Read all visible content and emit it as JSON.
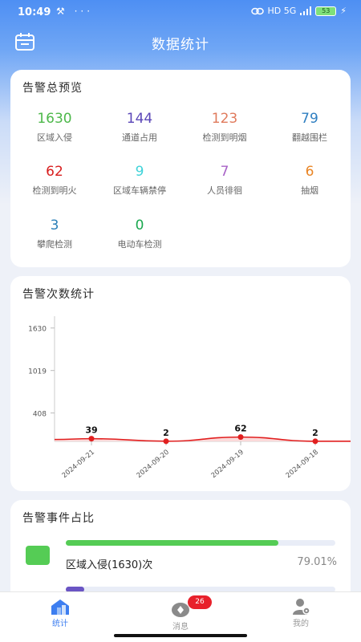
{
  "status_bar": {
    "time": "10:49",
    "left_icons": "⚒ ···",
    "net": "HD 5G",
    "battery": "53"
  },
  "header": {
    "title": "数据统计"
  },
  "overview": {
    "title": "告警总预览",
    "stats": [
      {
        "value": "1630",
        "label": "区域入侵",
        "color": "#4db84a"
      },
      {
        "value": "144",
        "label": "通道占用",
        "color": "#5b47b8"
      },
      {
        "value": "123",
        "label": "检测到明烟",
        "color": "#e07b5d"
      },
      {
        "value": "79",
        "label": "翻越围栏",
        "color": "#2f7fc1"
      },
      {
        "value": "62",
        "label": "检测到明火",
        "color": "#d81e1e"
      },
      {
        "value": "9",
        "label": "区域车辆禁停",
        "color": "#3fd3d9"
      },
      {
        "value": "7",
        "label": "人员徘徊",
        "color": "#a862c7"
      },
      {
        "value": "6",
        "label": "抽烟",
        "color": "#e98525"
      },
      {
        "value": "3",
        "label": "攀爬检测",
        "color": "#2b7fb8"
      },
      {
        "value": "0",
        "label": "电动车检测",
        "color": "#1aa84f"
      }
    ]
  },
  "count_chart": {
    "title": "告警次数统计",
    "chart_data": {
      "type": "area",
      "x": [
        "2024-09-21",
        "2024-09-20",
        "2024-09-19",
        "2024-09-18"
      ],
      "values": [
        39,
        2,
        62,
        2
      ],
      "yticks": [
        "1630",
        "1019",
        "408"
      ],
      "ytick_values": [
        1630,
        1019,
        408
      ],
      "ylim": [
        0,
        1800
      ],
      "grid": false,
      "line_color": "#e11f1f",
      "fill_color": "#fbdada"
    }
  },
  "ratio": {
    "title": "告警事件占比",
    "items": [
      {
        "label": "区域入侵(1630)次",
        "percent": "79.01%",
        "fraction": 0.7901,
        "color": "#55cc55"
      },
      {
        "fraction": 0.0698,
        "color": "#6a55c4"
      }
    ]
  },
  "nav": {
    "items": [
      {
        "label": "统计",
        "icon": "stats-home-icon",
        "active": true
      },
      {
        "label": "消息",
        "icon": "message-icon",
        "badge": "26"
      },
      {
        "label": "我的",
        "icon": "profile-settings-icon"
      }
    ]
  },
  "colors": {
    "accent": "#3d7ef0",
    "nav_inactive": "#9a9a9a"
  }
}
